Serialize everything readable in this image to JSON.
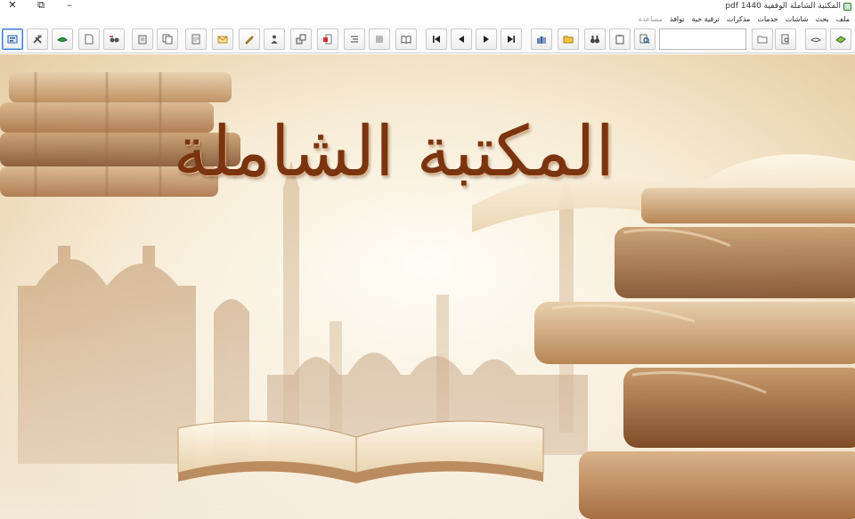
{
  "window": {
    "title": "المكتبة الشاملة الوقفية 1440 pdf"
  },
  "menu": [
    {
      "label": "ملف",
      "enabled": true
    },
    {
      "label": "بحث",
      "enabled": true
    },
    {
      "label": "شاشات",
      "enabled": true
    },
    {
      "label": "خدمات",
      "enabled": true
    },
    {
      "label": "مذكرات",
      "enabled": true
    },
    {
      "label": "ترقية حية",
      "enabled": true
    },
    {
      "label": "نوافذ",
      "enabled": true
    },
    {
      "label": "مساعدة",
      "enabled": false
    }
  ],
  "search": {
    "value": "",
    "placeholder": ""
  },
  "banner": {
    "title": "المكتبة الشاملة"
  }
}
